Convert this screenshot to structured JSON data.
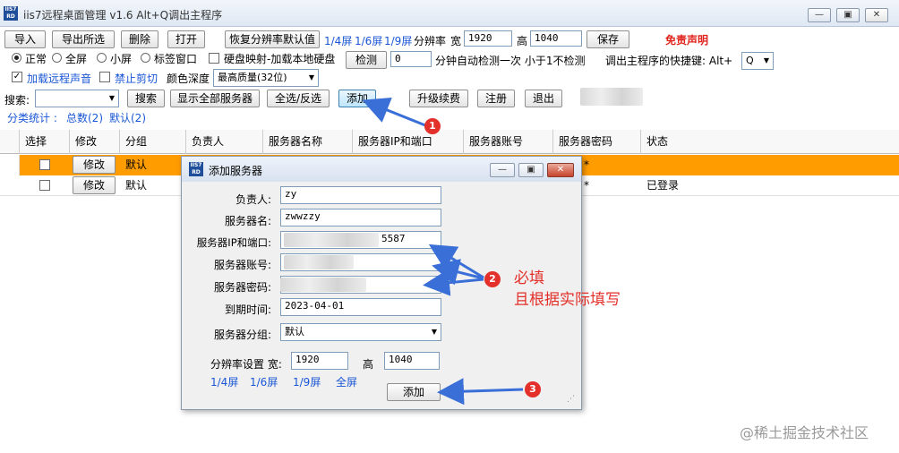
{
  "window": {
    "title": "iis7远程桌面管理 v1.6 Alt+Q调出主程序",
    "minimize": "—",
    "maximize": "▣",
    "close": "✕"
  },
  "toolbar1": {
    "import": "导入",
    "export": "导出所选",
    "delete": "删除",
    "open": "打开",
    "restore_res": "恢复分辨率默认值",
    "quarter": "1/4屏",
    "sixth": "1/6屏",
    "ninth": "1/9屏",
    "resolution_label": "分辨率",
    "width_label": "宽",
    "width_value": "1920",
    "height_label": "高",
    "height_value": "1040",
    "save": "保存",
    "disclaimer": "免责声明"
  },
  "toolbar2": {
    "normal": "正常",
    "fullscreen": "全屏",
    "small": "小屏",
    "tab_window": "标签窗口",
    "disk_map": "硬盘映射-加载本地硬盘",
    "detect": "检测",
    "detect_value": "0",
    "detect_desc": "分钟自动检测一次 小于1不检测",
    "hotkey_label": "调出主程序的快捷键: Alt+",
    "hotkey_value": "Q"
  },
  "toolbar3": {
    "remote_sound": "加载远程声音",
    "no_clipboard": "禁止剪切",
    "color_depth_label": "颜色深度",
    "color_depth_value": "最高质量(32位)"
  },
  "toolbar4": {
    "search_label": "搜索:",
    "search_value": "",
    "search": "搜索",
    "show_all": "显示全部服务器",
    "select_all": "全选/反选",
    "add": "添加",
    "upgrade": "升级续费",
    "register": "注册",
    "exit": "退出"
  },
  "stats": {
    "label": "分类统计 :",
    "total": "总数(2)",
    "default": "默认(2)"
  },
  "table": {
    "headers": [
      "选择",
      "修改",
      "分组",
      "负责人",
      "服务器名称",
      "服务器IP和端口",
      "服务器账号",
      "服务器密码",
      "状态"
    ],
    "rows": [
      {
        "edit": "修改",
        "group": "默认",
        "password": "*",
        "status": ""
      },
      {
        "edit": "修改",
        "group": "默认",
        "password": "*",
        "status": "已登录"
      }
    ]
  },
  "dialog": {
    "title": "添加服务器",
    "owner_label": "负责人:",
    "owner_value": "zy",
    "name_label": "服务器名:",
    "name_value": "zwwzzy",
    "ip_label": "服务器IP和端口:",
    "ip_value": "5587",
    "account_label": "服务器账号:",
    "password_label": "服务器密码:",
    "expire_label": "到期时间:",
    "expire_value": "2023-04-01",
    "group_label": "服务器分组:",
    "group_value": "默认",
    "res_label": "分辨率设置 宽:",
    "res_width": "1920",
    "res_height_label": "高",
    "res_height": "1040",
    "quarter": "1/4屏",
    "sixth": "1/6屏",
    "ninth": "1/9屏",
    "full": "全屏",
    "add": "添加"
  },
  "annotations": {
    "n1": "1",
    "n2": "2",
    "n3": "3",
    "note_line1": "必填",
    "note_line2": "且根据实际填写"
  },
  "watermark": "@稀土掘金技术社区",
  "colors": {
    "selected_row": "#ff9c00",
    "annotation": "#e3302a",
    "link": "#1a56d6",
    "arrow": "#3a6fd8"
  }
}
